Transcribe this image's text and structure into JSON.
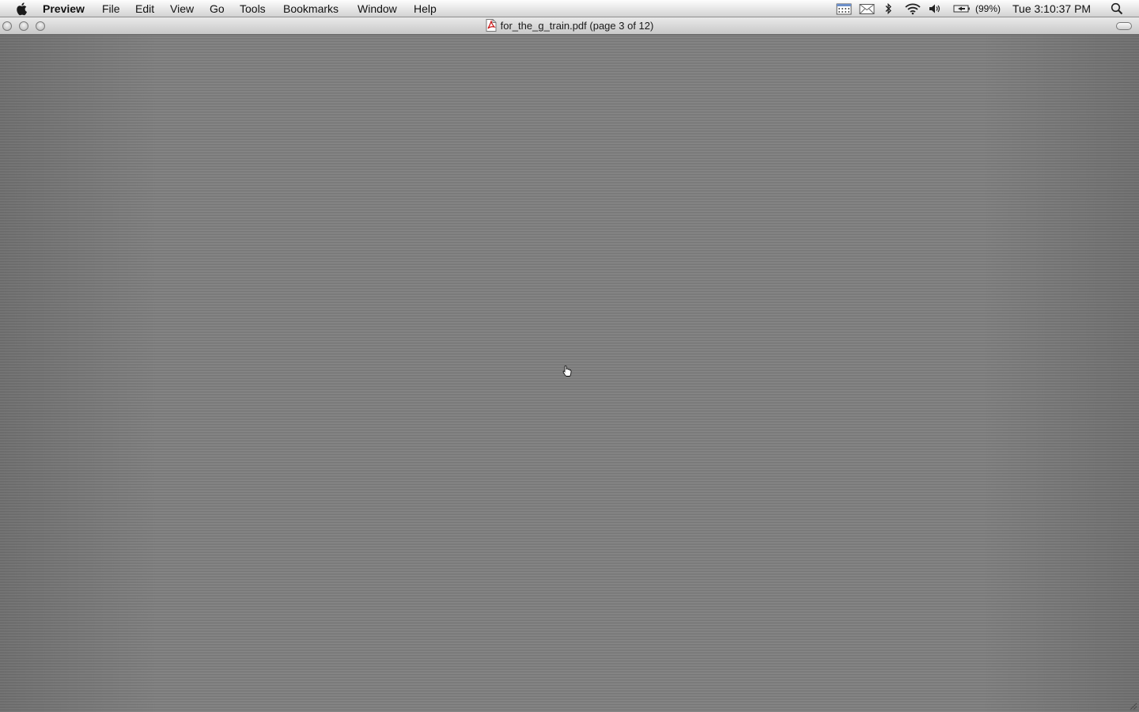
{
  "menubar": {
    "app_name": "Preview",
    "items": [
      "File",
      "Edit",
      "View",
      "Go",
      "Tools",
      "Bookmarks",
      "Window",
      "Help"
    ],
    "status": {
      "battery_percent": "(99%)",
      "clock": "Tue 3:10:37 PM"
    }
  },
  "window": {
    "title": "for_the_g_train.pdf (page 3 of 12)"
  },
  "icons": {
    "apple": "apple-icon",
    "calendar": "calendar-icon",
    "mail": "mail-icon",
    "bluetooth": "bluetooth-icon",
    "wifi": "wifi-icon",
    "volume": "volume-icon",
    "battery": "battery-icon",
    "spotlight": "spotlight-search-icon",
    "pdf": "pdf-document-icon"
  },
  "colors": {
    "menubar": "#e6e6e6",
    "document_background": "#7d7d7d"
  }
}
